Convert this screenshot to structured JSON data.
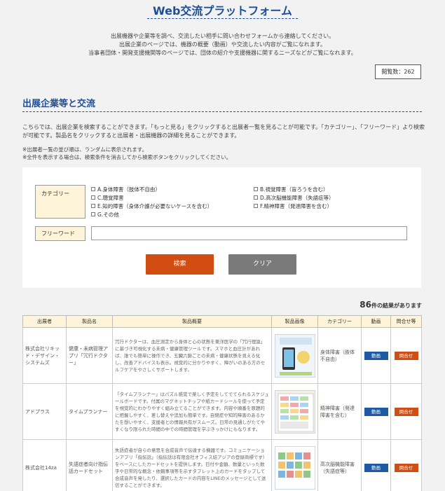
{
  "header": {
    "title": "Web交流プラットフォーム",
    "intro_lines": [
      "出展機器や企業等を調べ、交流したい相手に問い合わせフォームから連絡してください。",
      "出展企業のページでは、機器の概要（動画）や交流したい内容がご覧になれます。",
      "当事者団体・開発支援機関等のページでは、団体の紹介や支援機器に関するニーズなどがご覧になれます。"
    ],
    "view_count": "閲覧数：262"
  },
  "section": {
    "title": "出展企業等と交流",
    "description": "こちらでは、出展企業を検索することができます。「もっと見る」をクリックすると出展者一覧を見ることが可能です。「カテゴリー」、「フリーワード」より検索が可能です。製品名をクリックすると出展者・出展機器の詳細を見ることができます。",
    "notes": [
      "※出展者一覧の並び順は、ランダムに表示されます。",
      "※全件を表示する場合は、検索条件を消去してから検索ボタンをクリックしてください。"
    ]
  },
  "search": {
    "category_label": "カテゴリー",
    "categories": [
      "A.身体障害（肢体不自由）",
      "B.視覚障害（盲ろうを含む）",
      "C.聴覚障害",
      "D.高次脳機能障害（失語症等）",
      "E.知的障害（身体介護が必要ないケースを含む）",
      "F.精神障害（発達障害を含む）",
      "G.その他"
    ],
    "freeword_label": "フリーワード",
    "freeword_value": "",
    "search_button": "検索",
    "clear_button": "クリア"
  },
  "results": {
    "count": "86",
    "count_suffix": "件の結果があります",
    "headers": [
      "出展者",
      "製品名",
      "製品概要",
      "製品画像",
      "カテゴリー",
      "動画",
      "問合せ等"
    ],
    "video_label": "動画",
    "inquiry_label": "問合せ",
    "rows": [
      {
        "exhibitor": "株式会社リキッド・デザイン・システムズ",
        "product": "健康・未病管理アプリ「冗行ドクター」",
        "overview": "冗行ドクターは、血圧測定から身体と心の状態を東洋医学の「冗行理論」に基づき可視化する未病・健康管理ツールです。スマホと血圧計があれば、誰でも簡単に操作でき、五臓六腑ごとの未病・健康状態を見える化し、改善アドバイスも表示。視覚的に分かりやすく、障がいのある方のセルフケアをやさしくサポートします。",
        "category": "身体障害（肢体不自由）"
      },
      {
        "exhibitor": "アドプラス",
        "product": "タイムプランナー",
        "overview": "「タイムプランナー」はパズル感覚で楽しく予定をしてでてられるスケジュールボードです。付属のマグネットチップや紙カードシールを使って予定を視覚的にわかりやすく組み立てることができます。内容や順番を原題的に把握しやすく、差し替えや追加も簡単です。自閉症や知的障害のあるかたを想いやすく、支援者との情報共有がスムーズ。日常の見通しがたてやすくなり限られた時間の中での時間管理を学ぶきっかけにもなります。",
        "category": "精神障害（発達障害を含む）"
      },
      {
        "exhibitor": "株式会社14za",
        "product": "失語症者向け指伝話カードセット",
        "overview": "失語症者が自らの意思を合成音声で伝達する機器です。コミュニケーションアプリ「指伝話」（指伝話は有限会社オフィス結アジアの登録商標です）をベースにしたカードセットを提供します。日付や金額、数量といった数字や日常的な概念・依頼事項等を示すタブレット上のカードをタップして合成音声を発したり、選択したカードの内容をLINEのメッセージとして送信することができます。",
        "category": "高次脳機能障害（失語症等）"
      }
    ]
  }
}
